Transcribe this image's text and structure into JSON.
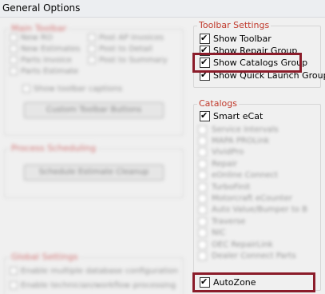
{
  "window": {
    "title": "General Options"
  },
  "colors": {
    "highlight": "#8b1c2a",
    "legend_red": "#c0392b"
  },
  "left_panel": {
    "group1": {
      "legend": "Main Toolbar",
      "items_col1": [
        "New RO",
        "New Estimates",
        "Parts Invoice",
        "Parts Estimate"
      ],
      "items_col2": [
        "Post AP Invoices",
        "Post to Detail",
        "Post to Summary"
      ],
      "show_captions": "Show toolbar captions",
      "button": "Custom Toolbar Buttons"
    },
    "group2": {
      "legend": "Process Scheduling",
      "button": "Schedule Estimate Cleanup"
    },
    "group3": {
      "legend": "Global Settings",
      "items": [
        "Enable multiple database configuration",
        "Enable technician/workflow processing"
      ]
    }
  },
  "toolbar_settings": {
    "legend": "Toolbar Settings",
    "items": [
      {
        "label": "Show Toolbar",
        "checked": true
      },
      {
        "label": "Show Repair Group",
        "checked": true
      },
      {
        "label": "Show Catalogs Group",
        "checked": true
      },
      {
        "label": "Show Quick Launch Group",
        "checked": true
      }
    ]
  },
  "catalogs": {
    "legend": "Catalogs",
    "first": {
      "label": "Smart eCat",
      "checked": true
    },
    "blurred_items": [
      "Service Intervals",
      "MAPA PROLink",
      "VividPro",
      "Repair",
      "eOnline Connect",
      "TurboFinit",
      "Motorcraft eCounter",
      "Auto Value/Bumper to B",
      "Traverse",
      "NIC",
      "OEC RepairLink",
      "Dealer Connect Parts"
    ],
    "last": {
      "label": "AutoZone",
      "checked": true
    }
  }
}
